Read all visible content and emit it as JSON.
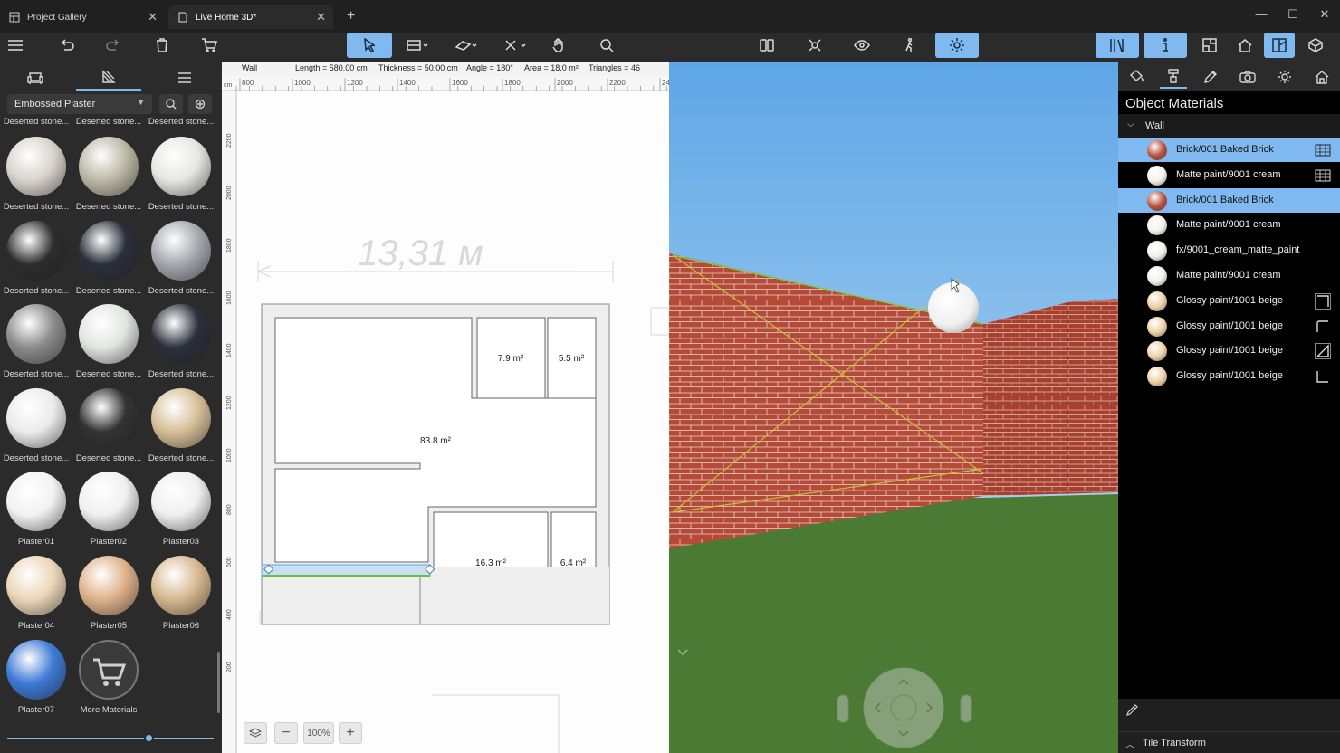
{
  "tabs": [
    {
      "label": "Project Gallery",
      "active": false
    },
    {
      "label": "Live Home 3D*",
      "active": true
    }
  ],
  "window_controls": {
    "minimize": "—",
    "maximize": "☐",
    "close": "✕"
  },
  "left_panel": {
    "filter": "Embossed Plaster",
    "top_row_labels": [
      "Deserted stone...",
      "Deserted stone...",
      "Deserted stone..."
    ],
    "materials": [
      {
        "label": "Deserted stone...",
        "color": "#d8d4cc"
      },
      {
        "label": "Deserted stone...",
        "color": "#bdb8a6"
      },
      {
        "label": "Deserted stone...",
        "color": "#e6e6e2"
      },
      {
        "label": "Deserted stone...",
        "color": "#2d2d2d"
      },
      {
        "label": "Deserted stone...",
        "color": "#2a2f3a"
      },
      {
        "label": "Deserted stone...",
        "color": "#a6a8b0"
      },
      {
        "label": "Deserted stone...",
        "color": "#8b8b8b"
      },
      {
        "label": "Deserted stone...",
        "color": "#e2e4e2"
      },
      {
        "label": "Deserted stone...",
        "color": "#2b2f3a"
      },
      {
        "label": "Deserted stone...",
        "color": "#ebebeb"
      },
      {
        "label": "Deserted stone...",
        "color": "#333333"
      },
      {
        "label": "Deserted stone...",
        "color": "#d6bf98"
      },
      {
        "label": "Plaster01",
        "color": "#f2f2f2"
      },
      {
        "label": "Plaster02",
        "color": "#f0f0f0"
      },
      {
        "label": "Plaster03",
        "color": "#efefef"
      },
      {
        "label": "Plaster04",
        "color": "#ecd6b8"
      },
      {
        "label": "Plaster05",
        "color": "#deb28a"
      },
      {
        "label": "Plaster06",
        "color": "#d7b890"
      },
      {
        "label": "Plaster07",
        "color": "#3d7ad6"
      },
      {
        "label": "More Materials",
        "color": "#3a3a3a"
      }
    ]
  },
  "plan": {
    "info": {
      "object": "Wall",
      "length": "Length = 580.00 cm",
      "thickness": "Thickness = 50.00 cm",
      "angle": "Angle = 180°",
      "area": "Area = 18.0 m²",
      "triangles": "Triangles = 46"
    },
    "ruler_unit": "cm",
    "ruler_ticks": [
      "800",
      "1000",
      "1200",
      "1400",
      "1600",
      "1800",
      "2000",
      "2200",
      "24"
    ],
    "vruler_ticks": [
      "2200",
      "2000",
      "1800",
      "1600",
      "1400",
      "1200",
      "1000",
      "800",
      "600",
      "400",
      "200"
    ],
    "dimension_text": "13,31 м",
    "rooms": [
      "7.9 m²",
      "5.5 m²",
      "83.8 m²",
      "16.3 m²",
      "6.4 m²"
    ],
    "zoom": "100%"
  },
  "right_panel": {
    "title": "Object Materials",
    "group": "Wall",
    "rows": [
      {
        "name": "Brick/001 Baked Brick",
        "color": "#b8523e",
        "selected": true,
        "icon": "map-icon"
      },
      {
        "name": "Matte paint/9001 cream",
        "color": "#f4f1ea",
        "selected": false,
        "icon": "map-icon"
      },
      {
        "name": "Brick/001 Baked Brick",
        "color": "#b8523e",
        "selected": true,
        "icon": ""
      },
      {
        "name": "Matte paint/9001 cream",
        "color": "#f4f1ea",
        "selected": false,
        "icon": ""
      },
      {
        "name": "fx/9001_cream_matte_paint",
        "color": "#f4f1ea",
        "selected": false,
        "icon": ""
      },
      {
        "name": "Matte paint/9001 cream",
        "color": "#f4f1ea",
        "selected": false,
        "icon": ""
      },
      {
        "name": "Glossy paint/1001 beige",
        "color": "#ecd2a6",
        "selected": false,
        "icon": "corner-icon"
      },
      {
        "name": "Glossy paint/1001 beige",
        "color": "#ecd2a6",
        "selected": false,
        "icon": "corner-icon"
      },
      {
        "name": "Glossy paint/1001 beige",
        "color": "#ecd2a6",
        "selected": false,
        "icon": "corner-icon"
      },
      {
        "name": "Glossy paint/1001 beige",
        "color": "#ecd2a6",
        "selected": false,
        "icon": "corner-icon"
      }
    ],
    "tile_transform": "Tile Transform"
  },
  "colors": {
    "accent": "#7fb9ef",
    "brick": "#b54a38",
    "grass": "#4b7a35",
    "sky": "#7cb7e6"
  }
}
